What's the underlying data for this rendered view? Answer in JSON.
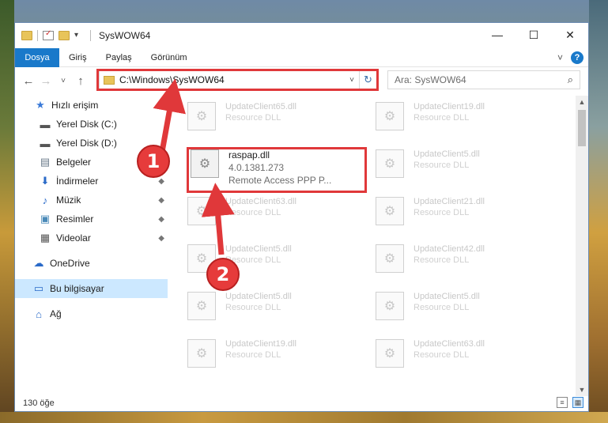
{
  "window": {
    "title": "SysWOW64",
    "minimize": "—",
    "maximize": "☐",
    "close": "✕"
  },
  "ribbon": {
    "tabs": [
      "Dosya",
      "Giriş",
      "Paylaş",
      "Görünüm"
    ],
    "expand": "˅",
    "help": "?"
  },
  "nav": {
    "back": "←",
    "forward": "→",
    "recent": "˅",
    "up": "↑",
    "address": "C:\\Windows\\SysWOW64",
    "address_drop": "˅",
    "refresh": "↻",
    "search_placeholder": "Ara: SysWOW64",
    "search_icon": "⌕"
  },
  "sidebar": {
    "items": [
      {
        "label": "Hızlı erişim",
        "icon": "star-icon",
        "glyph": "★",
        "pinned": false
      },
      {
        "label": "Yerel Disk (C:)",
        "icon": "drive-icon",
        "glyph": "▬",
        "pinned": false
      },
      {
        "label": "Yerel Disk (D:)",
        "icon": "drive-icon",
        "glyph": "▬",
        "pinned": false
      },
      {
        "label": "Belgeler",
        "icon": "documents-icon",
        "glyph": "▤",
        "pinned": false
      },
      {
        "label": "İndirmeler",
        "icon": "download-icon",
        "glyph": "⬇",
        "pinned": true
      },
      {
        "label": "Müzik",
        "icon": "music-icon",
        "glyph": "♪",
        "pinned": true
      },
      {
        "label": "Resimler",
        "icon": "pictures-icon",
        "glyph": "▣",
        "pinned": true
      },
      {
        "label": "Videolar",
        "icon": "video-icon",
        "glyph": "▦",
        "pinned": true
      },
      {
        "label": "OneDrive",
        "icon": "cloud-icon",
        "glyph": "☁",
        "pinned": false
      },
      {
        "label": "Bu bilgisayar",
        "icon": "computer-icon",
        "glyph": "▭",
        "pinned": false
      },
      {
        "label": "Ağ",
        "icon": "network-icon",
        "glyph": "⌂",
        "pinned": false
      }
    ],
    "pin_glyph": "📌"
  },
  "files": {
    "highlighted": {
      "name": "raspap.dll",
      "version": "4.0.1381.273",
      "description": "Remote Access PPP P..."
    },
    "left_column": [
      {
        "name": "UpdateClient65.dll",
        "type": "Resource DLL"
      },
      {
        "name": "UpdateClient63.dll",
        "type": "Resource DLL"
      },
      {
        "name": "UpdateClient5.dll",
        "type": "Resource DLL"
      },
      {
        "name": "UpdateClient5.dll",
        "type": "Resource DLL"
      },
      {
        "name": "UpdateClient19.dll",
        "type": "Resource DLL"
      }
    ],
    "right_column": [
      {
        "name": "UpdateClient19.dll",
        "type": "Resource DLL"
      },
      {
        "name": "UpdateClient5.dll",
        "type": "Resource DLL"
      },
      {
        "name": "UpdateClient21.dll",
        "type": "Resource DLL"
      },
      {
        "name": "UpdateClient42.dll",
        "type": "Resource DLL"
      },
      {
        "name": "UpdateClient5.dll",
        "type": "Resource DLL"
      },
      {
        "name": "UpdateClient63.dll",
        "type": "Resource DLL"
      }
    ]
  },
  "status": {
    "count": "130 öğe"
  },
  "annotations": {
    "step1": "1",
    "step2": "2",
    "color": "#e0383a"
  }
}
